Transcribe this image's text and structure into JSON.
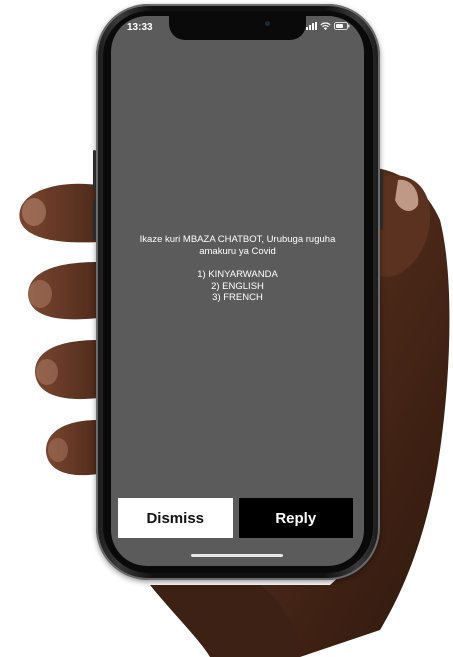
{
  "status_bar": {
    "time": "13:33"
  },
  "message": {
    "line1": "Ikaze kuri MBAZA CHATBOT, Urubuga ruguha",
    "line2": "amakuru ya Covid",
    "options": [
      "1) KINYARWANDA",
      "2) ENGLISH",
      "3) FRENCH"
    ]
  },
  "actions": {
    "dismiss_label": "Dismiss",
    "reply_label": "Reply"
  },
  "icons": {
    "signal": "signal-icon",
    "wifi": "wifi-icon",
    "battery": "battery-icon"
  },
  "colors": {
    "screen_bg": "#5b5b5b",
    "dismiss_bg": "#ffffff",
    "reply_bg": "#000000",
    "skin": "#4a2a1c"
  }
}
